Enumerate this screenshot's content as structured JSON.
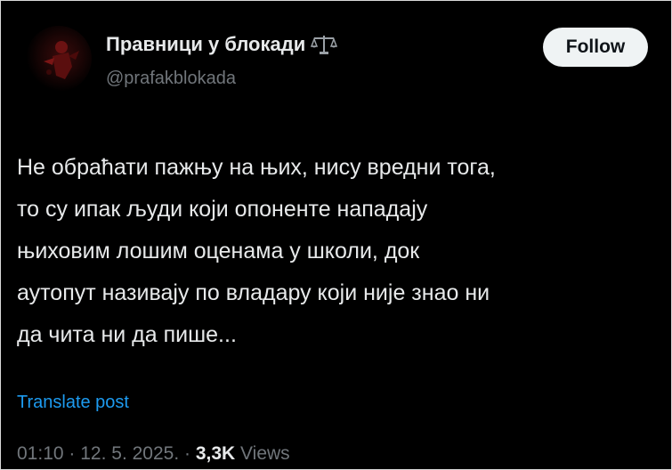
{
  "author": {
    "display_name": "Правници у блокади",
    "name_emoji_icon": "balance-scale-icon",
    "handle": "@prafakblokada"
  },
  "follow_button": {
    "label": "Follow"
  },
  "post": {
    "text": "Не обраћати пажњу на њих, нису вредни тога,\nто су ипак људи који опоненте нападају\nњиховим лошим оценама у школи, док\nаутопут називају по владару који није знао ни\nда чита ни да пише..."
  },
  "translate": {
    "label": "Translate post"
  },
  "meta": {
    "time": "01:10",
    "separator": " · ",
    "date": "12. 5. 2025.",
    "views_count": "3,3K",
    "views_label": " Views"
  },
  "colors": {
    "background": "#000000",
    "text": "#e7e9ea",
    "muted": "#71767b",
    "link": "#1d9bf0",
    "button_bg": "#eff3f4",
    "avatar_accent": "#8b1a1a"
  }
}
